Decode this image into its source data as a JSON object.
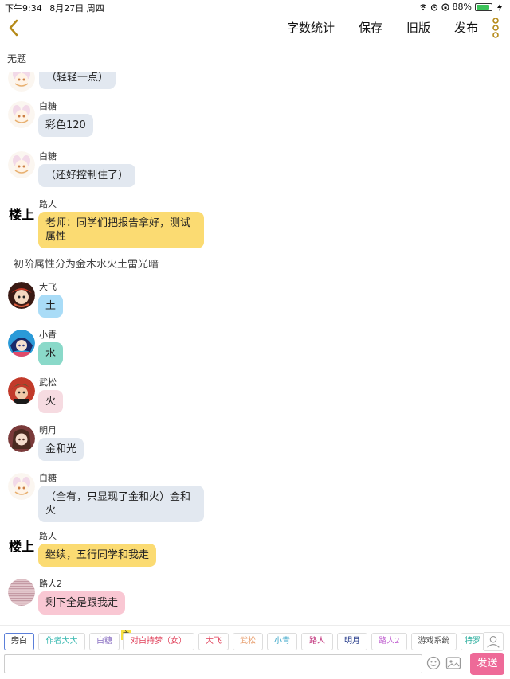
{
  "status_bar": {
    "time": "下午9:34",
    "date": "8月27日 周四",
    "battery_text": "88%",
    "battery_level": 0.88
  },
  "navbar": {
    "actions": [
      "字数统计",
      "保存",
      "旧版",
      "发布"
    ],
    "accent": "#b58a18"
  },
  "doc": {
    "title": "无题"
  },
  "messages": [
    {
      "speaker": "",
      "text": "（轻轻一点）",
      "style": "gray"
    },
    {
      "speaker": "白糖",
      "text": "彩色120",
      "style": "gray"
    },
    {
      "speaker": "白糖",
      "text": "（还好控制住了）",
      "style": "gray"
    },
    {
      "badge": "楼上",
      "speaker": "路人",
      "text": "老师：同学们把报告拿好，测试属性",
      "style": "yellow"
    },
    {
      "narration": "初阶属性分为金木水火土雷光暗"
    },
    {
      "speaker": "大飞",
      "text": "土",
      "style": "blue"
    },
    {
      "speaker": "小青",
      "text": "水",
      "style": "teal"
    },
    {
      "speaker": "武松",
      "text": "火",
      "style": "pink"
    },
    {
      "speaker": "明月",
      "text": "金和光",
      "style": "gray"
    },
    {
      "speaker": "白糖",
      "text": "（全有，只显现了金和火）金和火",
      "style": "gray"
    },
    {
      "badge": "楼上",
      "speaker": "路人",
      "text": "继续，五行同学和我走",
      "style": "yellow"
    },
    {
      "speaker": "路人2",
      "text": "剩下全是跟我走",
      "style": "pink2"
    }
  ],
  "characters": [
    {
      "label": "旁白",
      "color": "#222222",
      "active": true
    },
    {
      "label": "作者大大",
      "color": "#38b8b0"
    },
    {
      "label": "白糖",
      "color": "#8a6fc2"
    },
    {
      "label": "对白持梦（女）",
      "color": "#e0405a",
      "badge": "主"
    },
    {
      "label": "大飞",
      "color": "#e0405a"
    },
    {
      "label": "武松",
      "color": "#e8a070"
    },
    {
      "label": "小青",
      "color": "#3aa6c8"
    },
    {
      "label": "路人",
      "color": "#c0307a"
    },
    {
      "label": "明月",
      "color": "#243a8a"
    },
    {
      "label": "路人2",
      "color": "#c060d0"
    },
    {
      "label": "游戏系统",
      "color": "#555555"
    },
    {
      "label": "特罗",
      "color": "#30b0a0"
    }
  ],
  "input": {
    "value": "",
    "send_label": "发送"
  }
}
